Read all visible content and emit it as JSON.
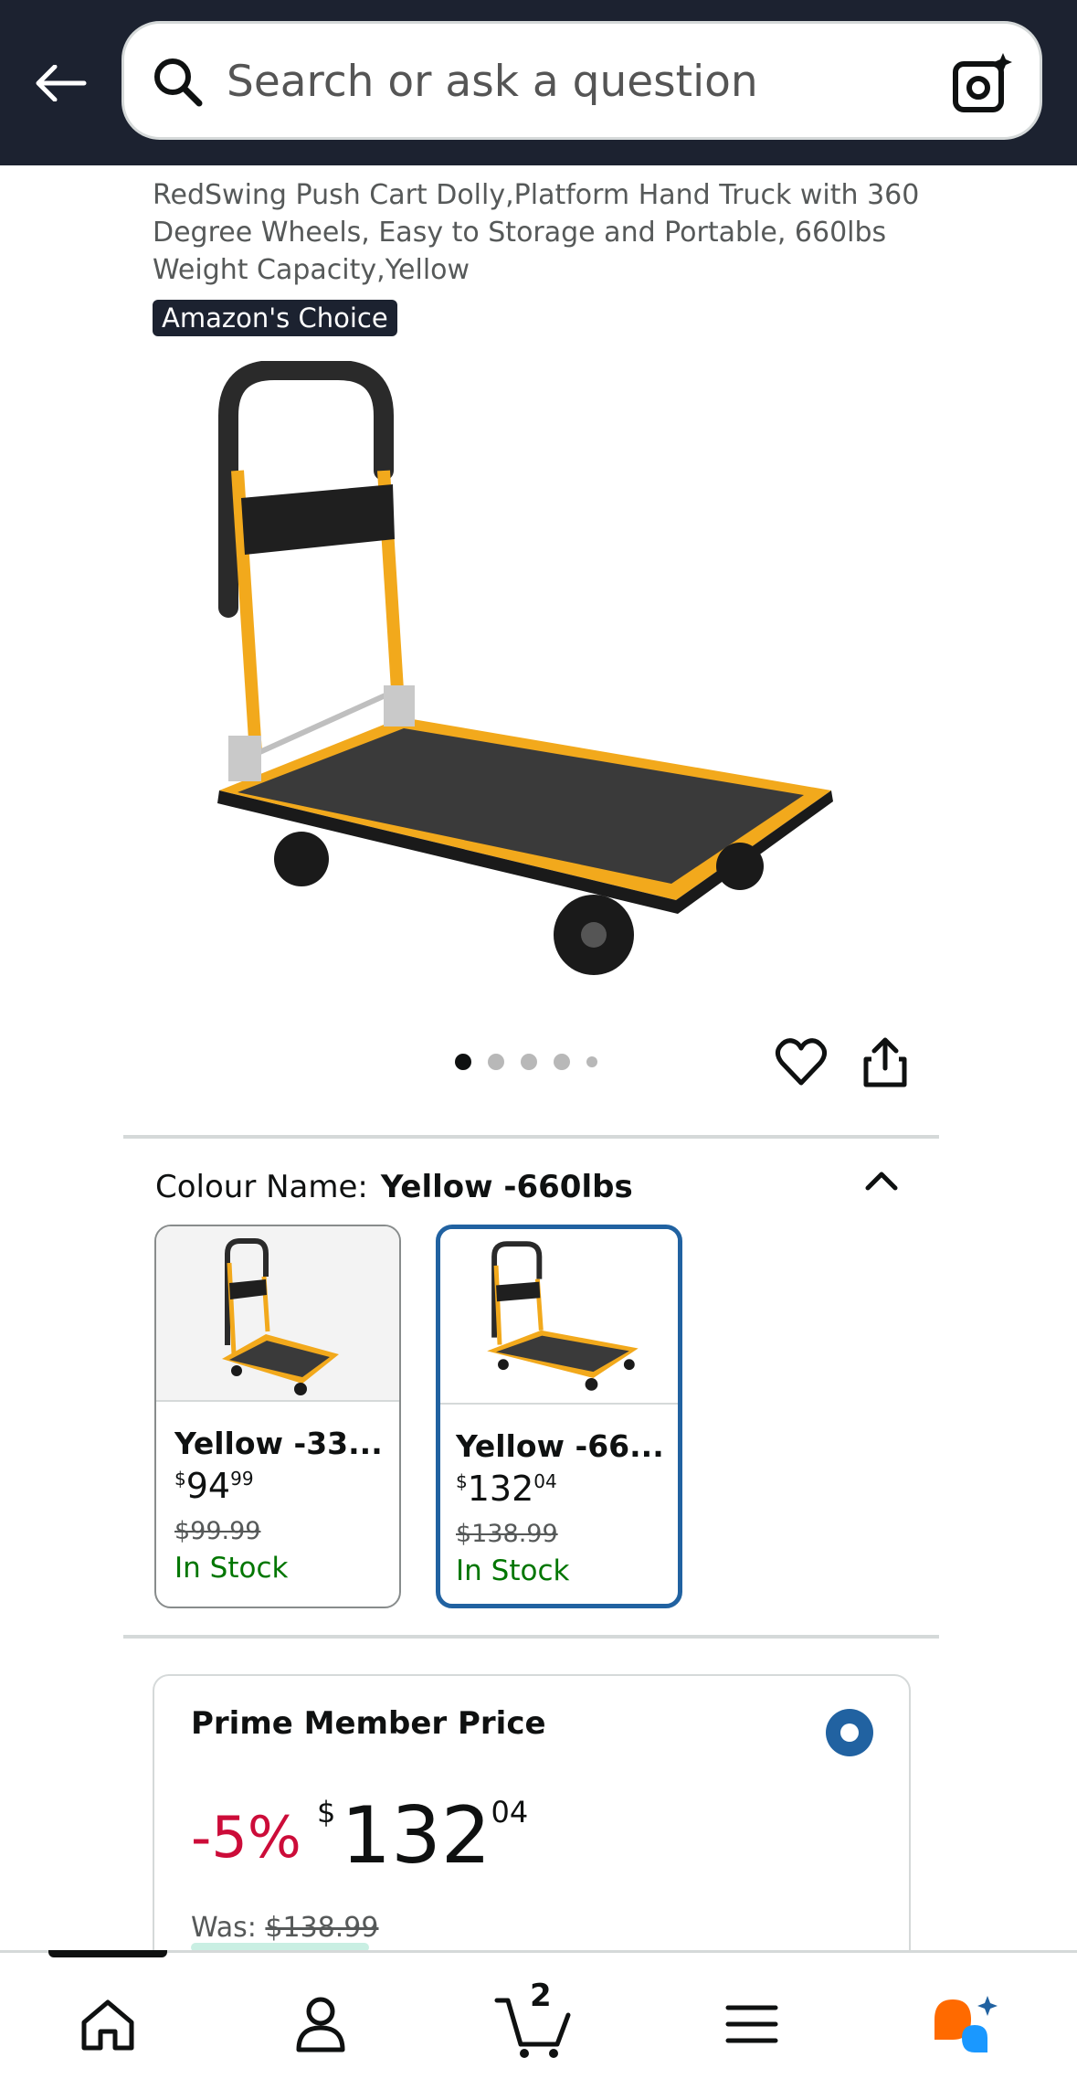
{
  "search": {
    "placeholder": "Search or ask a question"
  },
  "product": {
    "title": "RedSwing Push Cart Dolly,Platform Hand Truck with 360 Degree Wheels, Easy to Storage and Portable, 660lbs Weight Capacity,Yellow",
    "badge": "Amazon's Choice",
    "image_icon": "platform-cart",
    "carousel": {
      "count": 5,
      "active_index": 0
    }
  },
  "colour": {
    "label": "Colour Name:",
    "selected_value": "Yellow -660lbs",
    "options": [
      {
        "name": "Yellow -33...",
        "price_whole": "94",
        "price_fraction": "99",
        "currency": "$",
        "was": "$99.99",
        "stock": "In Stock",
        "selected": false
      },
      {
        "name": "Yellow -66...",
        "price_whole": "132",
        "price_fraction": "04",
        "currency": "$",
        "was": "$138.99",
        "stock": "In Stock",
        "selected": true
      }
    ]
  },
  "prime": {
    "title": "Prime Member Price",
    "discount": "-5%",
    "currency": "$",
    "price_whole": "132",
    "price_fraction": "04",
    "was_label": "Was:",
    "was_price": "$138.99"
  },
  "bottom_nav": {
    "items": [
      "home",
      "account",
      "cart",
      "menu",
      "rufus"
    ],
    "cart_count": "2"
  },
  "colors": {
    "header_bg": "#1c2230",
    "selected_border": "#2162a1",
    "discount_red": "#cc0c39",
    "stock_green": "#007600",
    "cart_yellow": "#f2a91c"
  }
}
